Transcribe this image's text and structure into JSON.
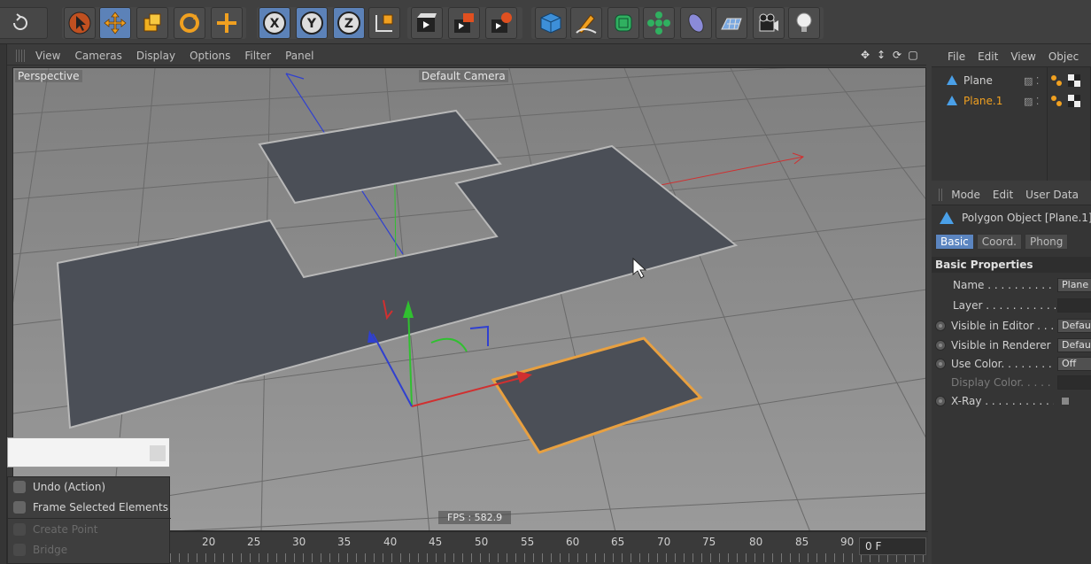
{
  "toolbar": {
    "buttons": [
      {
        "name": "undo-icon"
      },
      {
        "name": "select-tool-icon",
        "active": false
      },
      {
        "name": "move-tool-icon",
        "active": true
      },
      {
        "name": "scale-tool-icon"
      },
      {
        "name": "rotate-tool-icon"
      },
      {
        "name": "live-select-icon"
      },
      {
        "name": "x-axis-lock-icon",
        "label": "X"
      },
      {
        "name": "y-axis-lock-icon",
        "label": "Y"
      },
      {
        "name": "z-axis-lock-icon",
        "label": "Z"
      },
      {
        "name": "coordinate-system-icon"
      },
      {
        "name": "render-view-icon"
      },
      {
        "name": "render-picture-viewer-icon"
      },
      {
        "name": "render-settings-icon"
      },
      {
        "name": "cube-primitive-icon"
      },
      {
        "name": "spline-pen-icon"
      },
      {
        "name": "subdivision-icon"
      },
      {
        "name": "array-icon"
      },
      {
        "name": "deformer-icon"
      },
      {
        "name": "floor-icon"
      },
      {
        "name": "camera-icon"
      },
      {
        "name": "light-icon"
      }
    ]
  },
  "viewport": {
    "menu": [
      "View",
      "Cameras",
      "Display",
      "Options",
      "Filter",
      "Panel"
    ],
    "perspective_label": "Perspective",
    "camera_label": "Default Camera",
    "fps": "FPS : 582.9"
  },
  "timeline": {
    "ticks": [
      "20",
      "25",
      "30",
      "35",
      "40",
      "45",
      "50",
      "55",
      "60",
      "65",
      "70",
      "75",
      "80",
      "85",
      "90"
    ],
    "frame": "0 F"
  },
  "object_manager": {
    "menu": [
      "File",
      "Edit",
      "View",
      "Objec"
    ],
    "objects": [
      {
        "name": "Plane",
        "selected": false
      },
      {
        "name": "Plane.1",
        "selected": true
      }
    ]
  },
  "attribute_manager": {
    "menu": [
      "Mode",
      "Edit",
      "User Data"
    ],
    "title": "Polygon Object [Plane.1]",
    "tabs": [
      "Basic",
      "Coord.",
      "Phong"
    ],
    "section": "Basic Properties",
    "properties": [
      {
        "label": "Name . . . . . . . . . . .",
        "value": "Plane",
        "radio": false
      },
      {
        "label": "Layer . . . . . . . . . . .",
        "value": "",
        "radio": false
      },
      {
        "label": "Visible in Editor . . .",
        "value": "Defau",
        "radio": true
      },
      {
        "label": "Visible in Renderer",
        "value": "Defau",
        "radio": true
      },
      {
        "label": "Use Color. . . . . . . .",
        "value": "Off",
        "radio": true
      },
      {
        "label": "Display Color. . . . .",
        "value": "",
        "radio": false,
        "disabled": true
      },
      {
        "label": "X-Ray . . . . . . . . . . .",
        "value": "",
        "radio": true,
        "checkbox": true
      }
    ]
  },
  "context_menu": {
    "items": [
      {
        "label": "Undo (Action)",
        "enabled": true
      },
      {
        "label": "Frame Selected Elements",
        "enabled": true
      },
      {
        "label": "Create Point",
        "enabled": false
      },
      {
        "label": "Bridge",
        "enabled": false
      }
    ]
  },
  "colors": {
    "accent": "#5b85c0",
    "selection_outline": "#e8a040",
    "axis_x": "#d03030",
    "axis_y": "#30c030",
    "axis_z": "#3040d0",
    "plane_fill": "#4b4f57",
    "viewport_bg": "#8c8c8c"
  }
}
